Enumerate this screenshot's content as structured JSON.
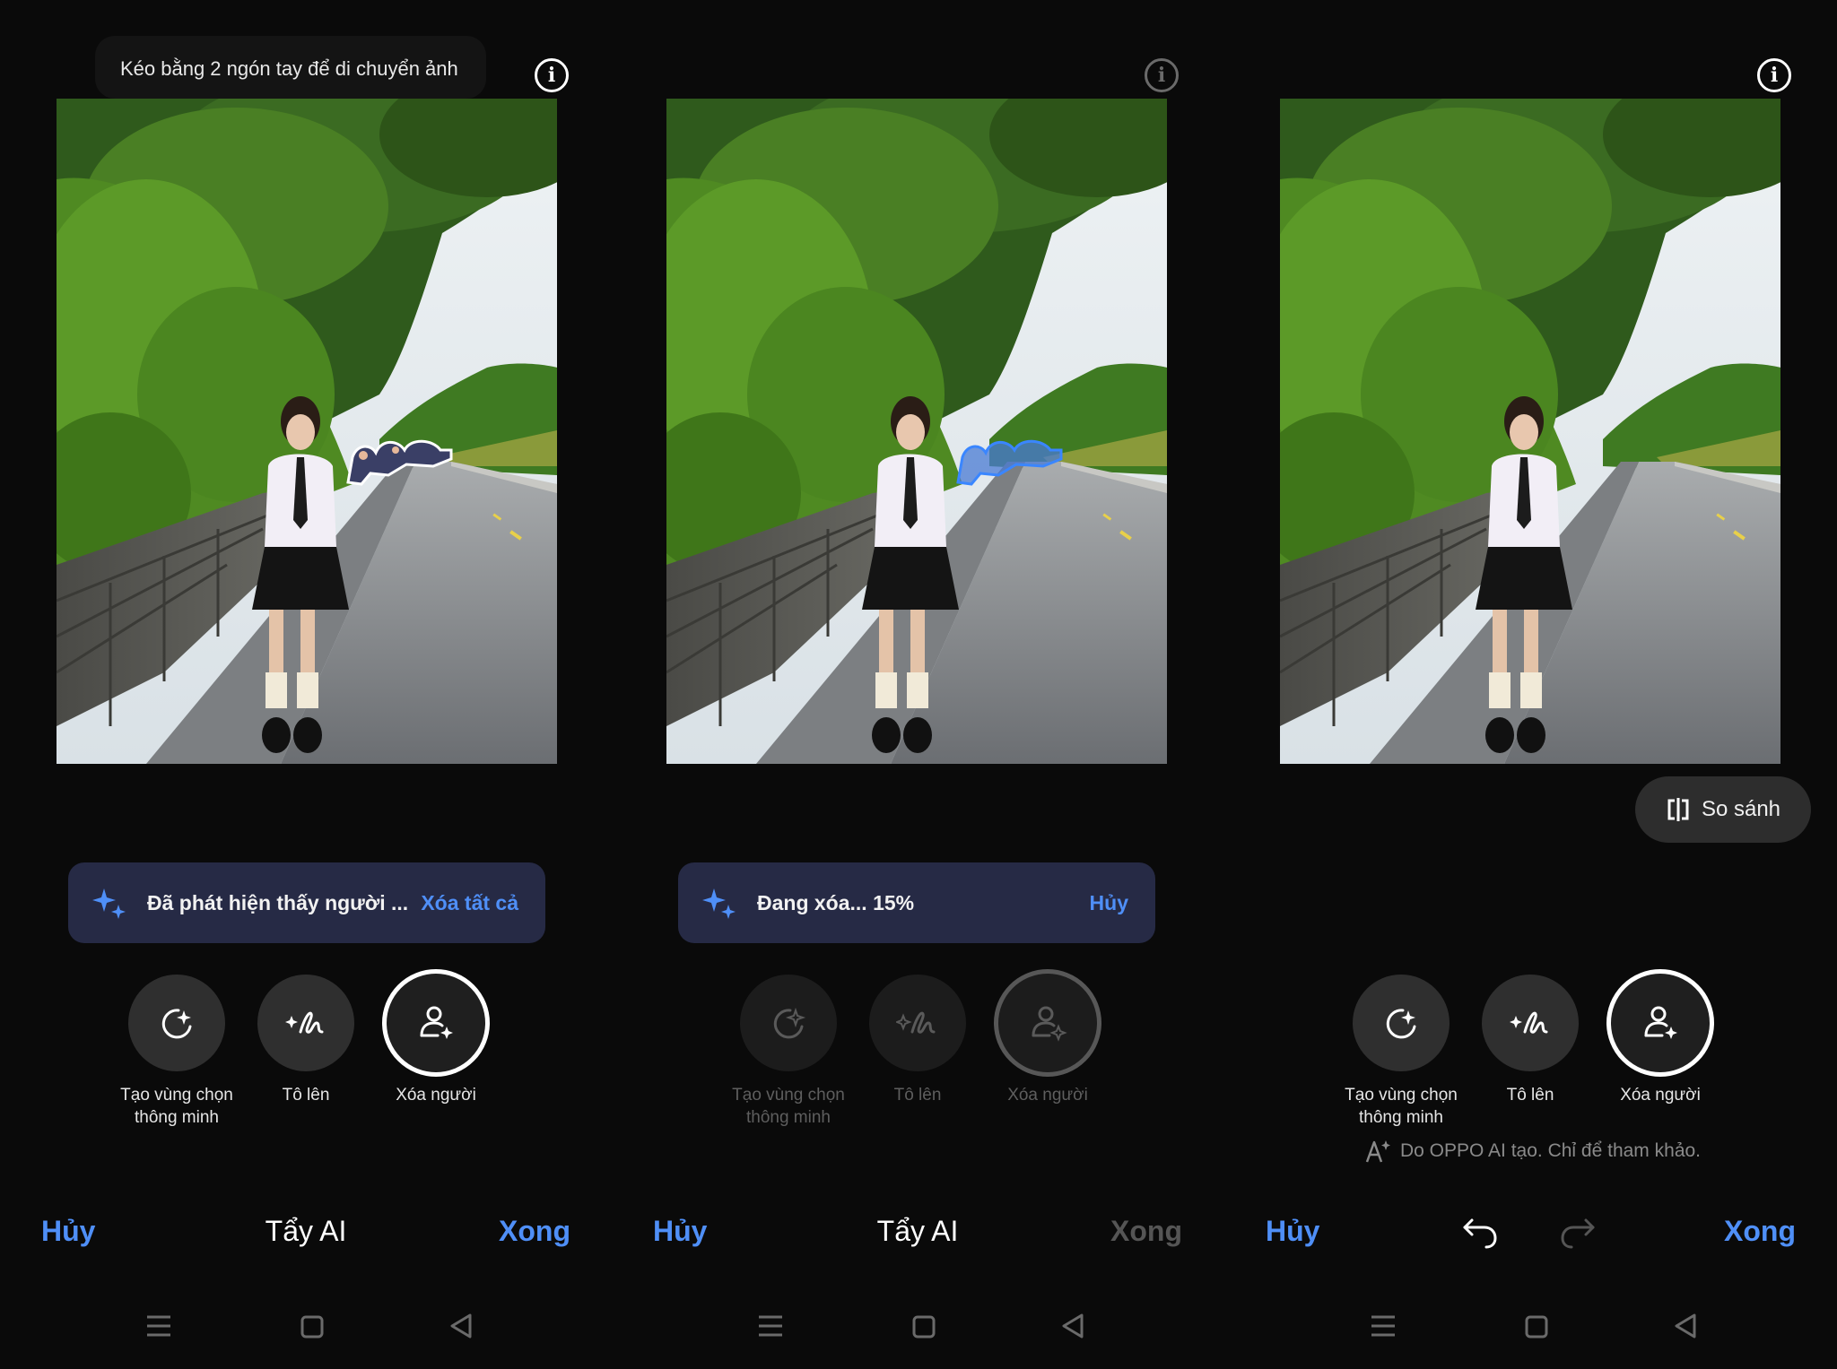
{
  "colors": {
    "accent": "#4f8ff7",
    "bar_bg": "#262a45",
    "screen_bg": "#0a0a0a",
    "highlight": "#3a86ff"
  },
  "panels": [
    {
      "tooltip": "Kéo bằng 2 ngón tay để di chuyển ảnh",
      "ai_message": "Đã phát hiện thấy người ...",
      "ai_action": "Xóa tất cả",
      "tools": [
        "Tạo vùng chọn thông minh",
        "Tô lên",
        "Xóa người"
      ],
      "cancel": "Hủy",
      "title": "Tẩy AI",
      "done": "Xong"
    },
    {
      "ai_message": "Đang xóa... 15%",
      "progress_percent": 15,
      "ai_action": "Hủy",
      "tools": [
        "Tạo vùng chọn thông minh",
        "Tô lên",
        "Xóa người"
      ],
      "cancel": "Hủy",
      "title": "Tẩy AI",
      "done": "Xong"
    },
    {
      "compare": "So sánh",
      "tools": [
        "Tạo vùng chọn thông minh",
        "Tô lên",
        "Xóa người"
      ],
      "disclaimer": "Do OPPO AI tạo. Chỉ để tham khảo.",
      "cancel": "Hủy",
      "done": "Xong"
    }
  ],
  "icons": {
    "info": "info-icon",
    "sparkle": "ai-sparkle-icon",
    "smart_select": "smart-select-icon",
    "brush": "brush-icon",
    "remove_people": "remove-people-icon",
    "compare": "compare-icon",
    "undo": "undo-icon",
    "redo": "redo-icon",
    "ai_generated": "ai-generated-icon"
  }
}
